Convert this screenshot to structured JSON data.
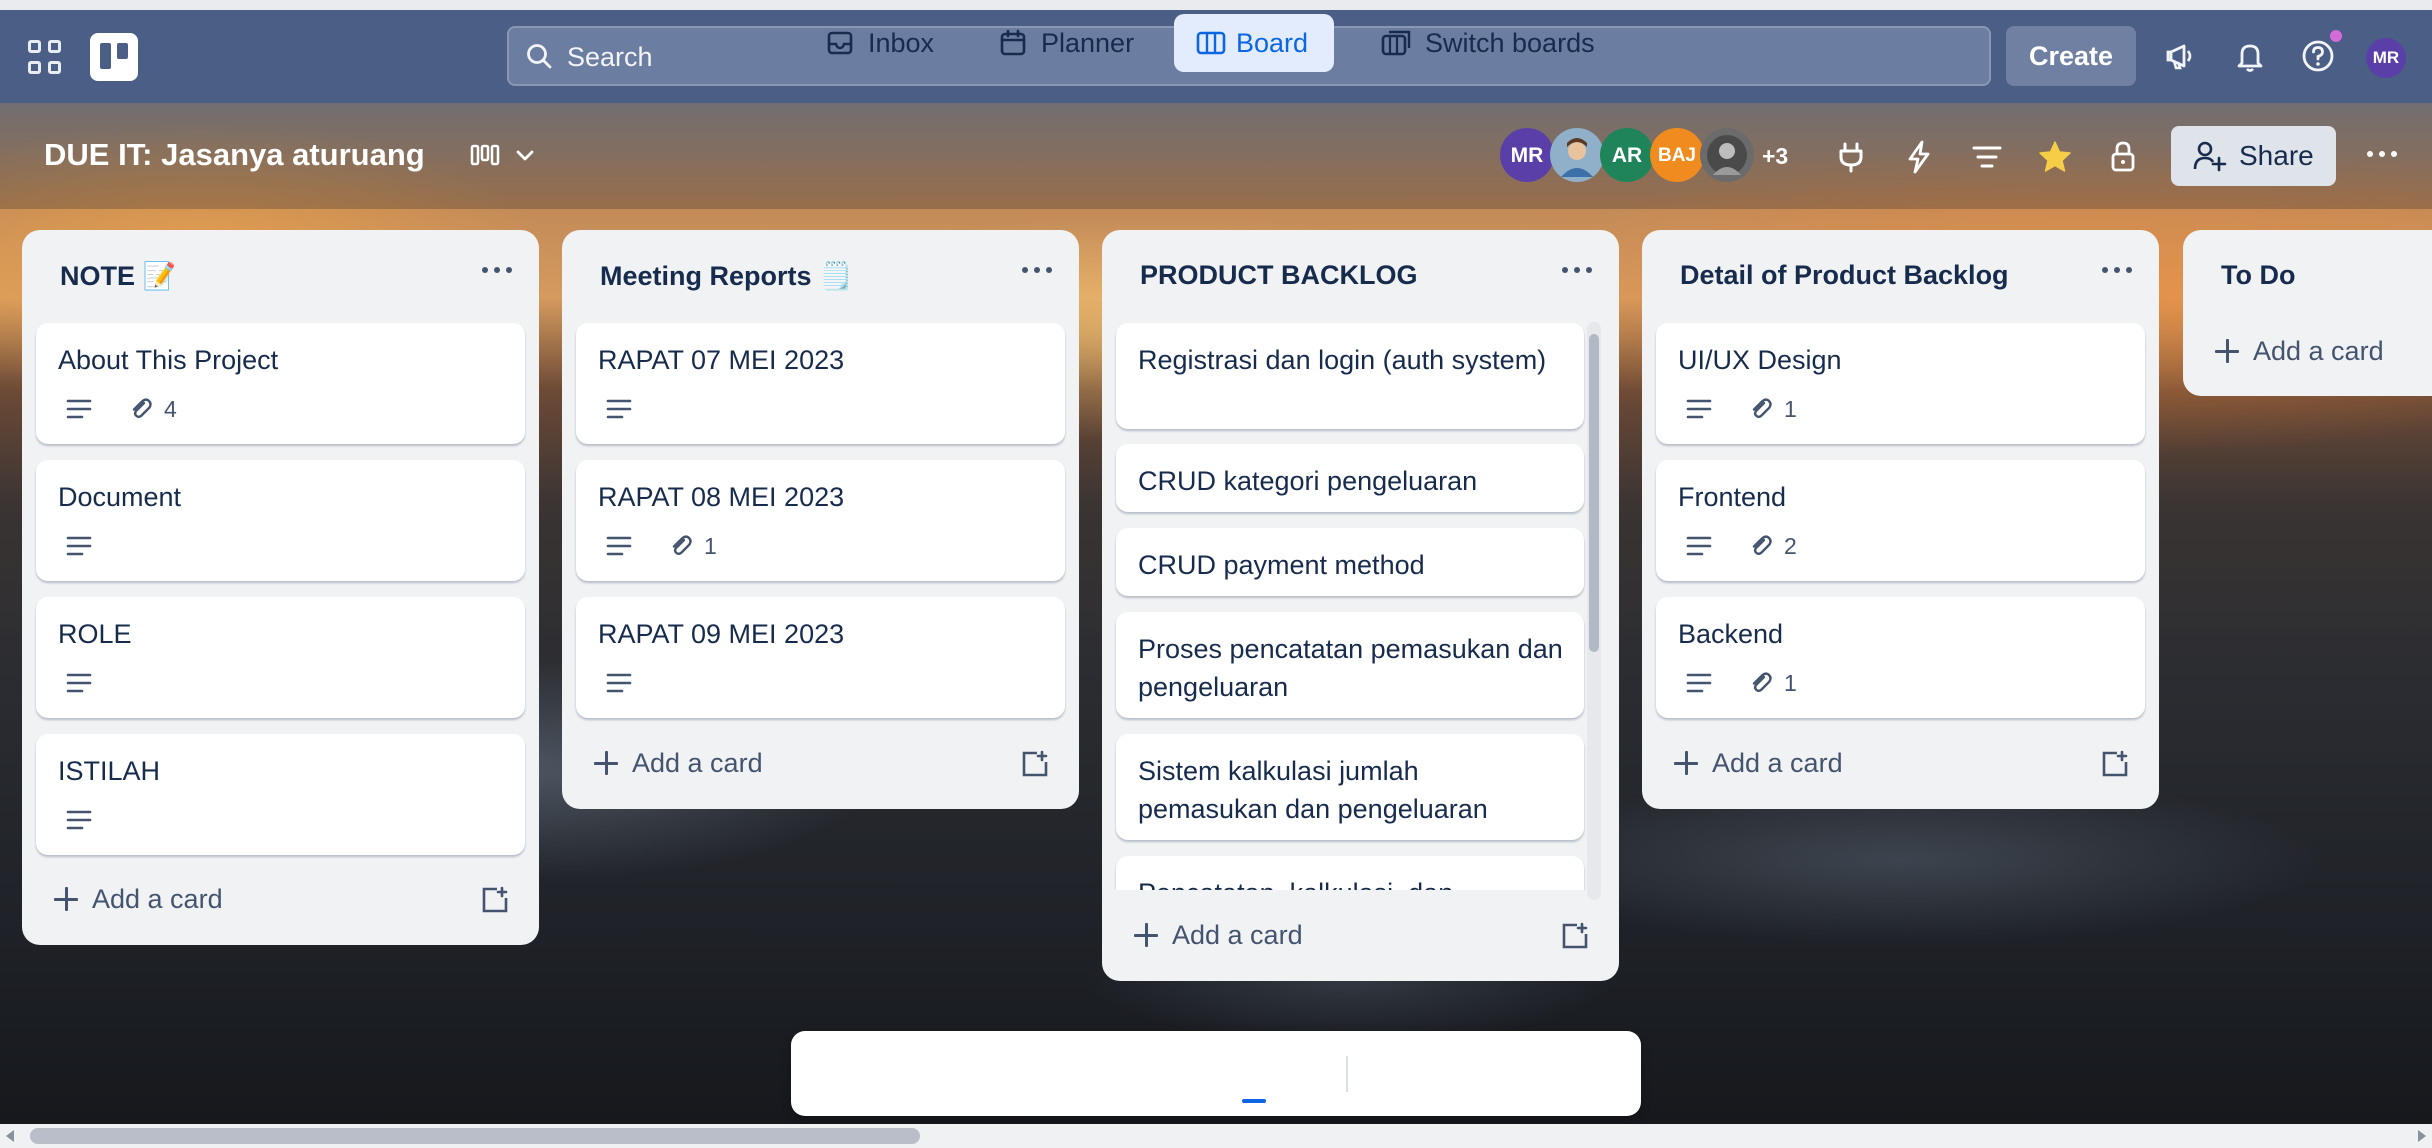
{
  "colors": {
    "nav_bg": "#4b5e86",
    "list_bg": "#f1f2f4",
    "card_bg": "#ffffff",
    "text_primary": "#172b4d",
    "text_subtle": "#44546f",
    "accent_blue": "#0c66e4",
    "star": "#f5cd47"
  },
  "topnav": {
    "search_placeholder": "Search",
    "create_label": "Create",
    "avatar_initials": "MR",
    "icons": [
      "apps-grid-icon",
      "trello-logo-icon",
      "search-icon",
      "megaphone-icon",
      "bell-icon",
      "help-icon"
    ]
  },
  "board": {
    "title": "DUE IT: Jasanya aturuang",
    "members": [
      {
        "initials": "MR",
        "color": "#5b3fa8"
      },
      {
        "initials": "",
        "color": "#8fb0c8"
      },
      {
        "initials": "AR",
        "color": "#1f845a"
      },
      {
        "initials": "BAJ",
        "color": "#f08c1f"
      },
      {
        "initials": "",
        "color": "#6b6b6b"
      }
    ],
    "more_members": "+3",
    "share_label": "Share",
    "icons": [
      "power-up-icon",
      "automation-icon",
      "filter-icon",
      "star-icon",
      "lock-icon",
      "more-icon"
    ]
  },
  "lists": [
    {
      "title": "NOTE 📝",
      "cards": [
        {
          "title": "About This Project",
          "desc": true,
          "attachments": "4"
        },
        {
          "title": "Document",
          "desc": true,
          "attachments": ""
        },
        {
          "title": "ROLE",
          "desc": true,
          "attachments": ""
        },
        {
          "title": "ISTILAH",
          "desc": true,
          "attachments": ""
        }
      ],
      "add_label": "Add a card"
    },
    {
      "title": "Meeting Reports 🗒️",
      "cards": [
        {
          "title": "RAPAT 07 MEI 2023",
          "desc": true,
          "attachments": ""
        },
        {
          "title": "RAPAT 08 MEI 2023",
          "desc": true,
          "attachments": "1"
        },
        {
          "title": "RAPAT 09 MEI 2023",
          "desc": true,
          "attachments": ""
        }
      ],
      "add_label": "Add a card"
    },
    {
      "title": "PRODUCT BACKLOG",
      "cards": [
        {
          "title": "Registrasi dan login (auth system)"
        },
        {
          "title": "CRUD kategori pengeluaran"
        },
        {
          "title": "CRUD payment method"
        },
        {
          "title": "Proses pencatatan pemasukan dan pengeluaran"
        },
        {
          "title": "Sistem kalkulasi jumlah pemasukan dan pengeluaran"
        },
        {
          "title": "Pencatatan, kalkulasi, dan"
        }
      ],
      "add_label": "Add a card"
    },
    {
      "title": "Detail of Product Backlog",
      "cards": [
        {
          "title": "UI/UX Design",
          "desc": true,
          "attachments": "1"
        },
        {
          "title": "Frontend",
          "desc": true,
          "attachments": "2"
        },
        {
          "title": "Backend",
          "desc": true,
          "attachments": "1"
        }
      ],
      "add_label": "Add a card"
    },
    {
      "title": "To Do",
      "cards": [],
      "add_label": "Add a card"
    }
  ],
  "switcher": {
    "items": [
      {
        "label": "Inbox",
        "icon": "inbox-icon",
        "active": false
      },
      {
        "label": "Planner",
        "icon": "calendar-icon",
        "active": false
      },
      {
        "label": "Board",
        "icon": "board-icon",
        "active": true
      },
      {
        "label": "Switch boards",
        "icon": "switch-boards-icon",
        "active": false
      }
    ]
  }
}
